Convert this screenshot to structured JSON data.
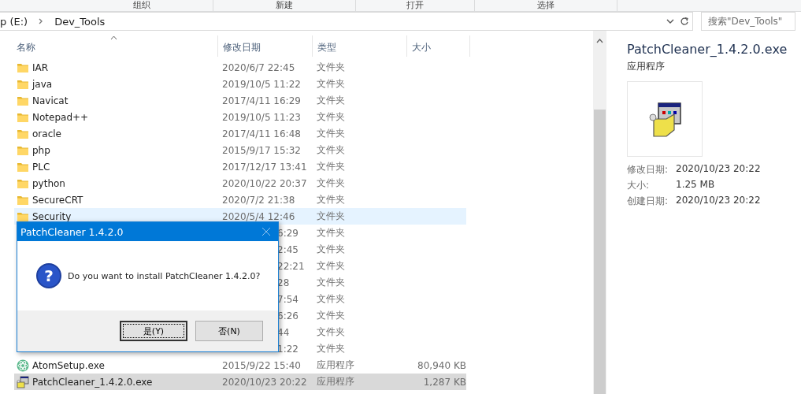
{
  "ribbon": {
    "groups": [
      "组织",
      "新建",
      "打开",
      "选择"
    ]
  },
  "address_bar": {
    "path": [
      {
        "label": "p (E:)"
      },
      {
        "label": "Dev_Tools"
      }
    ],
    "search": {
      "placeholder": "搜索\"Dev_Tools\""
    }
  },
  "file_list": {
    "columns": [
      "名称",
      "修改日期",
      "类型",
      "大小"
    ],
    "rows": [
      {
        "kind": "folder",
        "name": "IAR",
        "date": "2020/6/7 22:45",
        "type": "文件夹",
        "selected": false,
        "hover": false
      },
      {
        "kind": "folder",
        "name": "java",
        "date": "2019/10/5 11:22",
        "type": "文件夹",
        "selected": false,
        "hover": false
      },
      {
        "kind": "folder",
        "name": "Navicat",
        "date": "2017/4/11 16:29",
        "type": "文件夹",
        "selected": false,
        "hover": false
      },
      {
        "kind": "folder",
        "name": "Notepad++",
        "date": "2019/10/5 11:23",
        "type": "文件夹",
        "selected": false,
        "hover": false
      },
      {
        "kind": "folder",
        "name": "oracle",
        "date": "2017/4/11 16:48",
        "type": "文件夹",
        "selected": false,
        "hover": false
      },
      {
        "kind": "folder",
        "name": "php",
        "date": "2015/9/17 15:32",
        "type": "文件夹",
        "selected": false,
        "hover": false
      },
      {
        "kind": "folder",
        "name": "PLC",
        "date": "2017/12/17 13:41",
        "type": "文件夹",
        "selected": false,
        "hover": false
      },
      {
        "kind": "folder",
        "name": "python",
        "date": "2020/10/22 20:37",
        "type": "文件夹",
        "selected": false,
        "hover": false
      },
      {
        "kind": "folder",
        "name": "SecureCRT",
        "date": "2020/7/2 21:38",
        "type": "文件夹",
        "selected": false,
        "hover": false
      },
      {
        "kind": "folder",
        "name": "Security",
        "date": "2020/5/4 12:46",
        "type": "文件夹",
        "selected": false,
        "hover": true
      },
      {
        "kind": "covered",
        "date": "6:29",
        "type": "文件夹",
        "selected": false,
        "hover": false
      },
      {
        "kind": "covered",
        "date": "2:45",
        "type": "文件夹",
        "selected": false,
        "hover": false
      },
      {
        "kind": "covered",
        "date": "22:21",
        "type": "文件夹",
        "selected": false,
        "hover": false
      },
      {
        "kind": "covered",
        "date": "28",
        "type": "文件夹",
        "selected": false,
        "hover": false
      },
      {
        "kind": "covered",
        "date": "7:54",
        "type": "文件夹",
        "selected": false,
        "hover": false
      },
      {
        "kind": "covered",
        "date": "6:26",
        "type": "文件夹",
        "selected": false,
        "hover": false
      },
      {
        "kind": "covered",
        "date": "44",
        "type": "文件夹",
        "selected": false,
        "hover": false
      },
      {
        "kind": "covered",
        "date": "1:22",
        "type": "文件夹",
        "selected": false,
        "hover": false
      },
      {
        "kind": "atom",
        "name": "AtomSetup.exe",
        "date": "2015/9/22 15:40",
        "type": "应用程序",
        "size": "80,940 KB",
        "selected": false,
        "hover": false
      },
      {
        "kind": "installer",
        "name": "PatchCleaner_1.4.2.0.exe",
        "date": "2020/10/23 20:22",
        "type": "应用程序",
        "size": "1,287 KB",
        "selected": true,
        "hover": false
      }
    ]
  },
  "preview": {
    "title": "PatchCleaner_1.4.2.0.exe",
    "subtitle": "应用程序",
    "details": [
      {
        "label": "修改日期:",
        "value": "2020/10/23 20:22"
      },
      {
        "label": "大小:",
        "value": "1.25 MB"
      },
      {
        "label": "创建日期:",
        "value": "2020/10/23 20:22"
      }
    ]
  },
  "dialog": {
    "title": "PatchCleaner 1.4.2.0",
    "icon_glyph": "?",
    "message": "Do you want to install PatchCleaner 1.4.2.0?",
    "buttons": [
      {
        "label": "是(Y)",
        "focused": true
      },
      {
        "label": "否(N)",
        "focused": false
      }
    ]
  }
}
